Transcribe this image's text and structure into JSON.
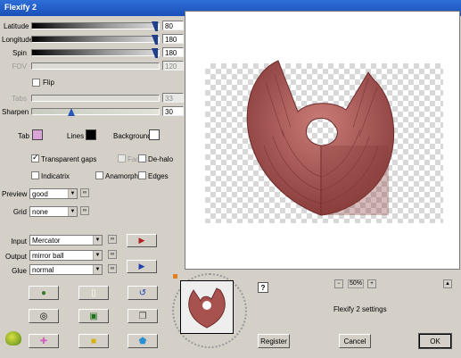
{
  "window": {
    "title": "Flexify 2"
  },
  "sliders": [
    {
      "label": "Latitude",
      "value": "80",
      "enabled": true
    },
    {
      "label": "Longitude",
      "value": "180",
      "enabled": true
    },
    {
      "label": "Spin",
      "value": "180",
      "enabled": true
    },
    {
      "label": "FOV",
      "value": "120",
      "enabled": false
    }
  ],
  "flip": {
    "label": "Flip",
    "checked": false
  },
  "tabs_slider": {
    "label": "Tabs",
    "value": "33",
    "enabled": false
  },
  "sharpen": {
    "label": "Sharpen",
    "value": "30"
  },
  "colors": {
    "tab": {
      "label": "Tab",
      "color": "#d9a5d9"
    },
    "lines": {
      "label": "Lines",
      "color": "#000000"
    },
    "background": {
      "label": "Background",
      "color": "#ffffff"
    }
  },
  "checkboxes": [
    {
      "label": "Transparent gaps",
      "checked": true,
      "enabled": true
    },
    {
      "label": "Faces",
      "checked": false,
      "enabled": false
    },
    {
      "label": "De-halo",
      "checked": false,
      "enabled": true
    },
    {
      "label": "Indicatrix",
      "checked": false,
      "enabled": true
    },
    {
      "label": "Anamorph",
      "checked": false,
      "enabled": true
    },
    {
      "label": "Edges",
      "checked": false,
      "enabled": true
    }
  ],
  "preview_select": {
    "label": "Preview",
    "value": "good"
  },
  "grid_select": {
    "label": "Grid",
    "value": "none"
  },
  "input_select": {
    "label": "Input",
    "value": "Mercator"
  },
  "output_select": {
    "label": "Output",
    "value": "mirror ball"
  },
  "glue_select": {
    "label": "Glue",
    "value": "normal"
  },
  "zoom": {
    "value": "50%"
  },
  "status_text": "Flexify 2 settings",
  "buttons": {
    "help": "?",
    "register": "Register",
    "cancel": "Cancel",
    "ok": "OK"
  },
  "accent": {
    "object": "#a8524f",
    "object_dark": "#6e2a2a"
  }
}
